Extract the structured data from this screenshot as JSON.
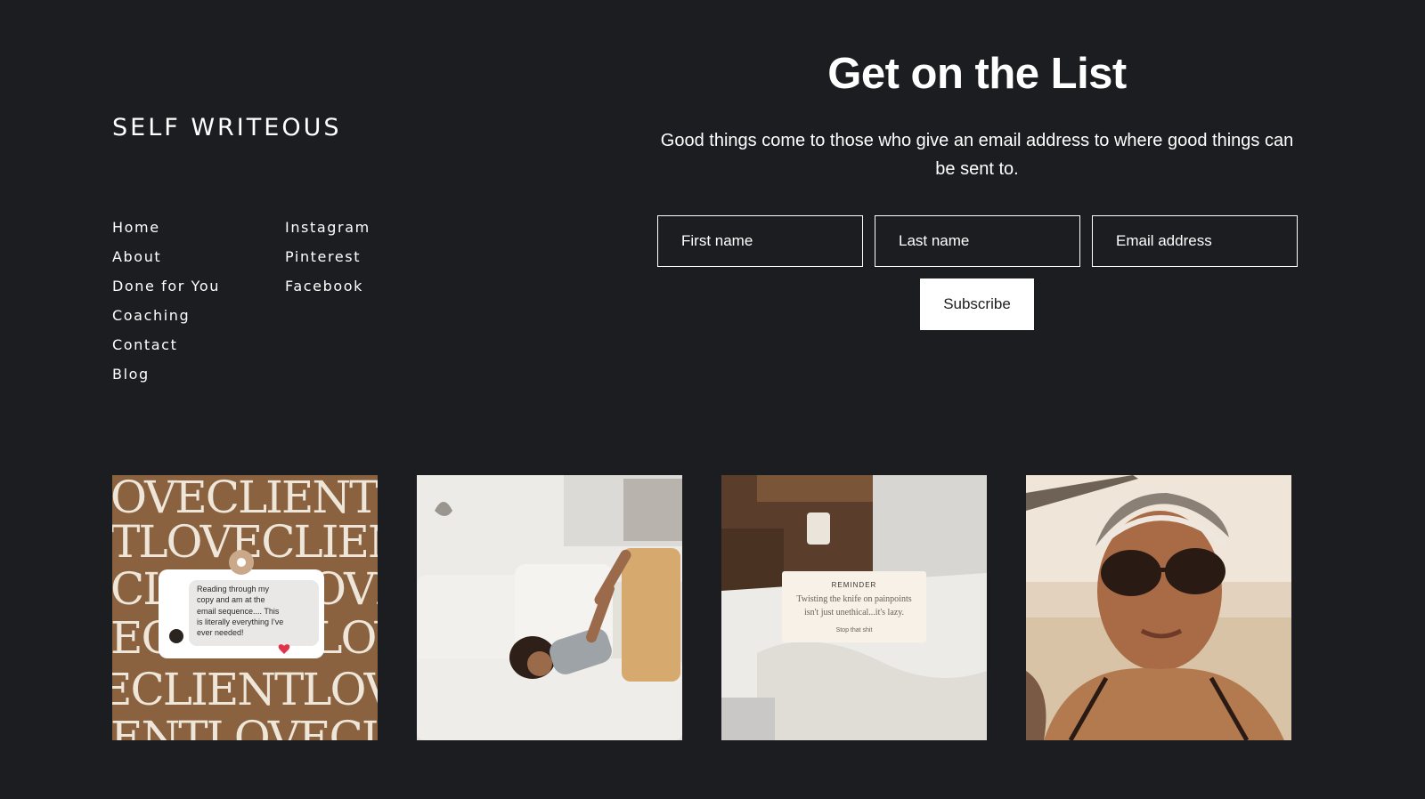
{
  "brand": {
    "name": "SELF WRITEOUS"
  },
  "nav": {
    "left": [
      "Home",
      "About",
      "Done for You",
      "Coaching",
      "Contact",
      "Blog"
    ],
    "right": [
      "Instagram",
      "Pinterest",
      "Facebook"
    ]
  },
  "signup": {
    "title": "Get on the List",
    "description": "Good things come to those who give an email address to where good things can be sent to.",
    "first_name_placeholder": "First name",
    "last_name_placeholder": "Last name",
    "email_placeholder": "Email address",
    "subscribe_label": "Subscribe"
  },
  "gallery": {
    "tile1": {
      "pattern_rows": [
        "OVECLIENTL",
        "TLOVECLIEN",
        "CLIENTLOVE",
        "ECLIENTLOV",
        "ECLIENTLOVE",
        "ENTLOVECLI"
      ],
      "message": [
        "Reading through my",
        "copy and am at the",
        "email sequence.... This",
        "is literally everything I've",
        "ever needed!"
      ]
    },
    "tile3": {
      "card_heading": "REMINDER",
      "card_text_line1": "Twisting the knife on painpoints",
      "card_text_line2": "isn't just unethical...it's lazy.",
      "card_footer": "Stop that shit"
    }
  },
  "colors": {
    "background": "#1c1d20",
    "text": "#ffffff",
    "tile_brown": "#8a6240"
  }
}
